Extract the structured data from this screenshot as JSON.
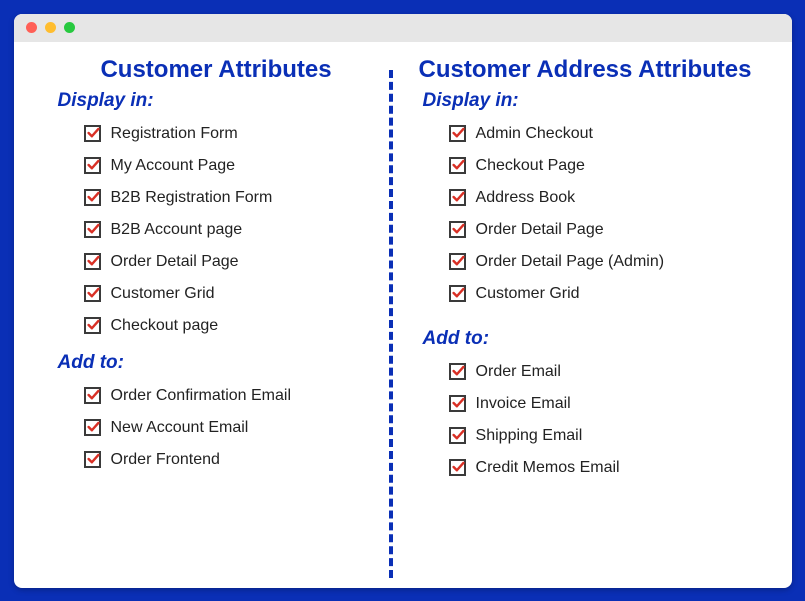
{
  "left": {
    "title": "Customer Attributes",
    "sections": {
      "display": {
        "label": "Display in:",
        "items": [
          "Registration Form",
          "My Account Page",
          "B2B Registration Form",
          "B2B Account page",
          "Order Detail Page",
          "Customer Grid",
          "Checkout page"
        ]
      },
      "add": {
        "label": "Add to:",
        "items": [
          "Order Confirmation Email",
          "New Account Email",
          "Order Frontend"
        ]
      }
    }
  },
  "right": {
    "title": "Customer Address Attributes",
    "sections": {
      "display": {
        "label": "Display in:",
        "items": [
          "Admin Checkout",
          "Checkout Page",
          "Address Book",
          "Order Detail Page",
          "Order Detail Page (Admin)",
          "Customer Grid"
        ]
      },
      "add": {
        "label": "Add to:",
        "items": [
          "Order Email",
          "Invoice Email",
          "Shipping Email",
          "Credit Memos Email"
        ]
      }
    }
  }
}
